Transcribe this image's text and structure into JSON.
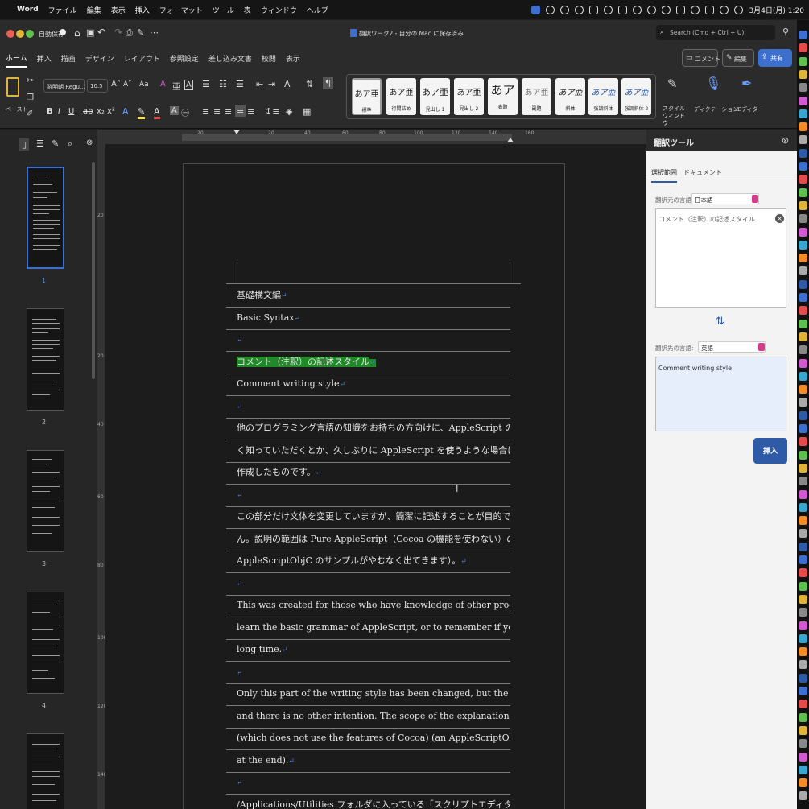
{
  "menubar": {
    "items": [
      "Word",
      "ファイル",
      "編集",
      "表示",
      "挿入",
      "フォーマット",
      "ツール",
      "表",
      "ウィンドウ",
      "ヘルプ"
    ],
    "clock": "3月4日(月)  1:20"
  },
  "titlebar": {
    "autosave": "自動保存",
    "autosave_state": "オフ",
    "title": "翻訳ワーク2 - 自分の Mac に保存済み",
    "search_placeholder": "Search (Cmd + Ctrl + U)"
  },
  "ribbon": {
    "tabs": [
      "ホーム",
      "挿入",
      "描画",
      "デザイン",
      "レイアウト",
      "参照設定",
      "差し込み文書",
      "校閲",
      "表示"
    ],
    "comment_button": "コメント",
    "edit_button": "編集",
    "share_button": "共有"
  },
  "toolbar": {
    "paste_label": "ペースト",
    "font_name": "游明朝 Regu...",
    "font_size": "10.5",
    "styles": [
      {
        "preview": "あア亜",
        "name": "標準"
      },
      {
        "preview": "あア亜",
        "name": "行間詰め"
      },
      {
        "preview": "あア亜",
        "name": "見出し 1"
      },
      {
        "preview": "あア亜",
        "name": "見出し 2"
      },
      {
        "preview": "あア",
        "name": "表題"
      },
      {
        "preview": "あア亜",
        "name": "副題"
      },
      {
        "preview": "あア亜",
        "name": "斜体"
      },
      {
        "preview": "あア亜",
        "name": "強調斜体"
      },
      {
        "preview": "あア亜",
        "name": "強調斜体 2"
      }
    ],
    "style_window": "スタイル ウィンドウ",
    "dictation": "ディクテーション",
    "editor": "エディター"
  },
  "ruler": {
    "h_ticks": [
      "20",
      "20",
      "40",
      "60",
      "80",
      "100",
      "120",
      "140",
      "160"
    ],
    "v_ticks": [
      "20",
      "20",
      "40",
      "60",
      "80",
      "100",
      "120",
      "140"
    ]
  },
  "thumbnails": {
    "page_numbers": [
      "1",
      "2",
      "3",
      "4"
    ]
  },
  "document": {
    "return_mark": "↵",
    "lines": [
      "基礎構文編",
      "Basic Syntax",
      "",
      "コメント（注釈）の記述スタイル",
      "Comment writing style",
      "",
      "他のプログラミング言語の知識をお持ちの方向けに、AppleScript の基礎文法を手っ取り早",
      "く知っていただくとか、久しぶりに AppleScript を使うような場合に思い出すことを目的に",
      "作成したものです。",
      "",
      "この部分だけ文体を変更していますが、簡潔に記述することが目的であり、他意はありませ",
      "ん。説明の範囲は Pure AppleScript（Cocoa の機能を使わない）の範囲とします（最後に",
      "AppleScriptObjC のサンプルがやむなく出てきます）。",
      "",
      "This was created for those who have knowledge of other programming languages to quickly",
      "learn the basic grammar of AppleScript, or to remember if you haven't used AppleScript in a",
      "long time.",
      "",
      "Only this part of the writing style has been changed, but the purpose is to describe it concisely,",
      "and there is no other intention. The scope of the explanation is the scope of Pure AppleScript",
      "(which does not use the features of Cocoa) (an AppleScriptObjC sample will inevitably appear",
      "at the end).",
      "",
      "/Applications/Utilities フォルダに入っている「スクリプトエディタ」を使って AppleScript"
    ]
  },
  "translator": {
    "title": "翻訳ツール",
    "tab_selection": "選択範囲",
    "tab_document": "ドキュメント",
    "source_label": "翻訳元の言語:",
    "source_lang": "日本語",
    "source_text": "コメント（注釈）の記述スタイル",
    "target_label": "翻訳先の言語:",
    "target_lang": "英語",
    "target_text": "Comment writing style",
    "insert_button": "挿入"
  },
  "colors": {
    "accent": "#2e5aa6",
    "highlight": "#1f8a27",
    "share": "#3d6fcf"
  }
}
